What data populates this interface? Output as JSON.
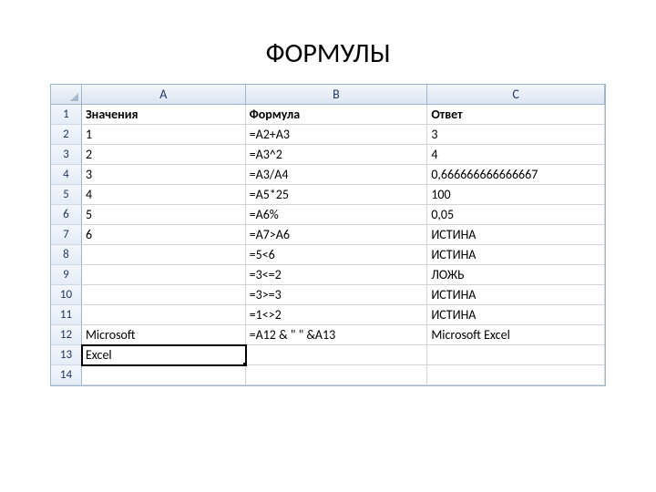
{
  "title": "ФОРМУЛЫ",
  "columns": [
    "A",
    "B",
    "C"
  ],
  "rowNumbers": [
    "1",
    "2",
    "3",
    "4",
    "5",
    "6",
    "7",
    "8",
    "9",
    "10",
    "11",
    "12",
    "13",
    "14"
  ],
  "headers": {
    "A": "Значения",
    "B": "Формула",
    "C": "Ответ"
  },
  "rows": [
    {
      "A": "1",
      "B": "=А2+А3",
      "C": "3"
    },
    {
      "A": "2",
      "B": "=А3^2",
      "C": "4"
    },
    {
      "A": "3",
      "B": "=А3/А4",
      "C": "0,666666666666667"
    },
    {
      "A": "4",
      "B": "=А5*25",
      "C": "100"
    },
    {
      "A": "5",
      "B": "=А6%",
      "C": "0,05"
    },
    {
      "A": "6",
      "B": "=А7>А6",
      "C": "ИСТИНА"
    },
    {
      "A": "",
      "B": "=5<6",
      "C": "ИСТИНА"
    },
    {
      "A": "",
      "B": "=3<=2",
      "C": "ЛОЖЬ"
    },
    {
      "A": "",
      "B": "=3>=3",
      "C": "ИСТИНА"
    },
    {
      "A": "",
      "B": "=1<>2",
      "C": "ИСТИНА"
    },
    {
      "A": "Microsoft",
      "B": "=А12 & \" \" &А13",
      "C": "Microsoft Excel"
    },
    {
      "A": "Excel",
      "B": "",
      "C": ""
    },
    {
      "A": "",
      "B": "",
      "C": ""
    }
  ],
  "activeCell": {
    "row": 13,
    "col": "A"
  }
}
